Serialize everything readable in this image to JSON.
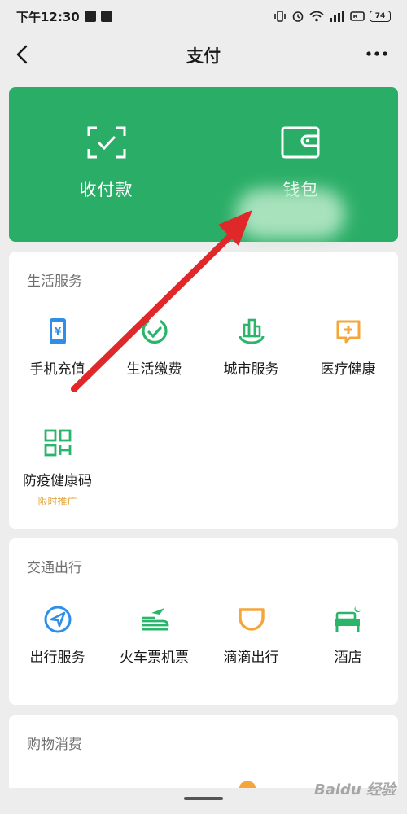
{
  "status_bar": {
    "time": "下午12:30",
    "battery": "74"
  },
  "nav": {
    "title": "支付"
  },
  "pay_card": {
    "items": [
      {
        "label": "收付款",
        "icon": "scan-icon"
      },
      {
        "label": "钱包",
        "icon": "wallet-icon"
      }
    ]
  },
  "sections": {
    "life": {
      "title": "生活服务",
      "items": [
        {
          "label": "手机充值",
          "icon": "phone-recharge-icon"
        },
        {
          "label": "生活缴费",
          "icon": "utility-payment-icon"
        },
        {
          "label": "城市服务",
          "icon": "city-service-icon"
        },
        {
          "label": "医疗健康",
          "icon": "medical-health-icon"
        },
        {
          "label": "防疫健康码",
          "sub": "限时推广",
          "icon": "health-code-icon"
        }
      ]
    },
    "transport": {
      "title": "交通出行",
      "items": [
        {
          "label": "出行服务",
          "icon": "travel-service-icon"
        },
        {
          "label": "火车票机票",
          "icon": "train-flight-icon"
        },
        {
          "label": "滴滴出行",
          "icon": "didi-icon"
        },
        {
          "label": "酒店",
          "icon": "hotel-icon"
        }
      ]
    },
    "shopping": {
      "title": "购物消费"
    }
  },
  "watermark": "Baidu 经验",
  "colors": {
    "brand_green": "#2aae67",
    "icon_blue": "#2f8fe8",
    "icon_green": "#2ab56b",
    "icon_orange": "#f5a63a",
    "annotation_red": "#e0272a",
    "promo_text": "#e0a53a"
  }
}
